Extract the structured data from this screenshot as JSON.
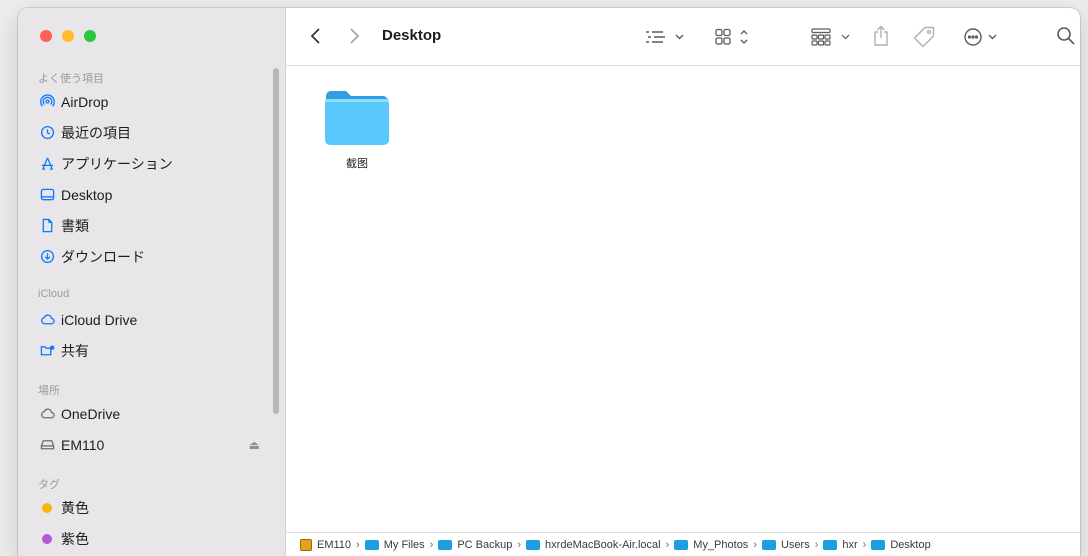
{
  "toolbar": {
    "title": "Desktop"
  },
  "sidebar": {
    "sections": [
      {
        "heading": "よく使う項目",
        "items": [
          {
            "label": "AirDrop",
            "icon": "airdrop-icon"
          },
          {
            "label": "最近の項目",
            "icon": "clock-icon"
          },
          {
            "label": "アプリケーション",
            "icon": "applications-icon"
          },
          {
            "label": "Desktop",
            "icon": "desktop-icon"
          },
          {
            "label": "書類",
            "icon": "document-icon"
          },
          {
            "label": "ダウンロード",
            "icon": "download-icon"
          }
        ]
      },
      {
        "heading": "iCloud",
        "items": [
          {
            "label": "iCloud Drive",
            "icon": "cloud-icon"
          },
          {
            "label": "共有",
            "icon": "shared-folder-icon"
          }
        ]
      },
      {
        "heading": "場所",
        "items": [
          {
            "label": "OneDrive",
            "icon": "cloud-icon"
          },
          {
            "label": "EM110",
            "icon": "drive-icon"
          }
        ]
      },
      {
        "heading": "タグ",
        "items": [
          {
            "label": "黄色",
            "color": "#f5b70f"
          },
          {
            "label": "紫色",
            "color": "#b25ad6"
          }
        ]
      }
    ]
  },
  "content": {
    "items": [
      {
        "label": "截图",
        "icon": "folder-icon"
      }
    ]
  },
  "pathbar": {
    "crumbs": [
      "EM110",
      "My Files",
      "PC Backup",
      "hxrdeMacBook-Air.local",
      "My_Photos",
      "Users",
      "hxr",
      "Desktop"
    ]
  },
  "colors": {
    "accent": "#0a7aff",
    "folder": "#5ac8fa"
  }
}
